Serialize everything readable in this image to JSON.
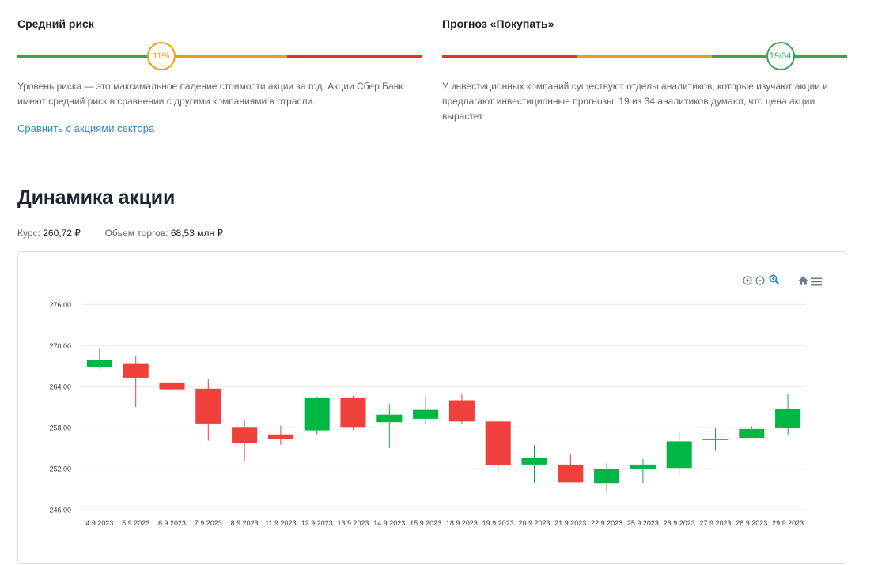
{
  "risk": {
    "title": "Средний риск",
    "value_label": "11%",
    "value_pct": 0.355,
    "segments": [
      "#2fa84f",
      "#f39c12",
      "#d9352b"
    ],
    "circle_color": "#f39c12",
    "description": "Уровень риска — это максимальное падение стоимости акции за год. Акции Сбер Банк имеют средний риск в сравнении с другими компаниями в отрасли.",
    "link": "Сравнить с акциями сектора"
  },
  "forecast": {
    "title": "Прогноз «Покупать»",
    "value_label": "19/34",
    "value_pct": 0.835,
    "segments": [
      "#d9352b",
      "#f39c12",
      "#2fa84f"
    ],
    "circle_color": "#2fa84f",
    "description": "У инвестиционных компаний существуют отделы аналитиков, которые изучают акции и предлагают инвестиционные прогнозы. 19 из 34 аналитиков думают, что цена акции вырастет."
  },
  "dynamics": {
    "title": "Динамика акции",
    "price_label": "Курс:",
    "price_value": "260,72 ₽",
    "volume_label": "Обьем торгов:",
    "volume_value": "68,53 млн ₽"
  },
  "toolbar": {
    "zoom_in": "zoom-in-icon",
    "zoom_out": "zoom-out-icon",
    "zoom": "magnifier-icon",
    "home": "home-icon",
    "menu": "menu-icon",
    "active_color": "#2a8bc9",
    "icon_color": "#6e7b8b"
  },
  "chart_data": {
    "type": "candlestick",
    "title": "",
    "xlabel": "",
    "ylabel": "",
    "ylim": [
      246,
      278
    ],
    "yticks": [
      "246.00",
      "252.00",
      "258.00",
      "264.00",
      "270.00",
      "276.00"
    ],
    "up_color": "#00b746",
    "down_color": "#ef403c",
    "grid": true,
    "categories": [
      "4.9.2023",
      "5.9.2023",
      "6.9.2023",
      "7.9.2023",
      "8.9.2023",
      "11.9.2023",
      "12.9.2023",
      "13.9.2023",
      "14.9.2023",
      "15.9.2023",
      "18.9.2023",
      "19.9.2023",
      "20.9.2023",
      "21.9.2023",
      "22.9.2023",
      "25.9.2023",
      "26.9.2023",
      "27.9.2023",
      "28.9.2023",
      "29.9.2023"
    ],
    "ohlc": [
      {
        "open": 266.9,
        "high": 269.6,
        "low": 266.6,
        "close": 267.9
      },
      {
        "open": 267.3,
        "high": 268.4,
        "low": 261.0,
        "close": 265.3
      },
      {
        "open": 264.5,
        "high": 264.9,
        "low": 262.3,
        "close": 263.6
      },
      {
        "open": 263.7,
        "high": 265.1,
        "low": 256.1,
        "close": 258.6
      },
      {
        "open": 258.1,
        "high": 259.2,
        "low": 253.1,
        "close": 255.7
      },
      {
        "open": 257.0,
        "high": 258.3,
        "low": 255.5,
        "close": 256.3
      },
      {
        "open": 257.6,
        "high": 262.5,
        "low": 257.0,
        "close": 262.3
      },
      {
        "open": 262.3,
        "high": 262.6,
        "low": 257.7,
        "close": 258.1
      },
      {
        "open": 258.8,
        "high": 261.5,
        "low": 255.0,
        "close": 259.9
      },
      {
        "open": 259.3,
        "high": 262.6,
        "low": 258.5,
        "close": 260.6
      },
      {
        "open": 262.0,
        "high": 262.9,
        "low": 258.6,
        "close": 258.9
      },
      {
        "open": 258.9,
        "high": 259.2,
        "low": 251.6,
        "close": 252.5
      },
      {
        "open": 252.6,
        "high": 255.5,
        "low": 249.9,
        "close": 253.6
      },
      {
        "open": 252.6,
        "high": 254.2,
        "low": 250.1,
        "close": 250.0
      },
      {
        "open": 249.9,
        "high": 252.8,
        "low": 248.5,
        "close": 252.0
      },
      {
        "open": 251.9,
        "high": 253.4,
        "low": 249.9,
        "close": 252.6
      },
      {
        "open": 252.1,
        "high": 257.3,
        "low": 251.1,
        "close": 256.0
      },
      {
        "open": 256.3,
        "high": 257.9,
        "low": 254.6,
        "close": 256.3
      },
      {
        "open": 256.5,
        "high": 258.2,
        "low": 256.5,
        "close": 257.8
      },
      {
        "open": 257.9,
        "high": 262.9,
        "low": 256.9,
        "close": 260.7
      }
    ]
  }
}
